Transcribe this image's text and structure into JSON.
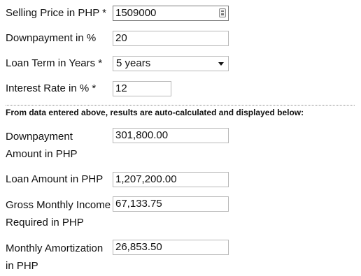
{
  "inputs": {
    "selling_price": {
      "label": "Selling Price in PHP *",
      "value": "1509000",
      "icon": "field-picker-icon"
    },
    "downpayment_percent": {
      "label": "Downpayment in %",
      "value": "20"
    },
    "loan_term": {
      "label": "Loan Term in Years *",
      "selected": "5 years"
    },
    "interest_rate": {
      "label": "Interest Rate in % *",
      "value": "12"
    }
  },
  "notice": "From data entered above, results are auto-calculated and displayed below:",
  "results": {
    "downpayment_amount": {
      "label_line1": "Downpayment",
      "label_line2": "Amount in PHP",
      "value": "301,800.00"
    },
    "loan_amount": {
      "label": "Loan Amount in PHP",
      "value": "1,207,200.00"
    },
    "gross_income": {
      "label_line1": "Gross Monthly Income",
      "label_line2": "Required in PHP",
      "value": "67,133.75"
    },
    "monthly_amortization": {
      "label_line1": "Monthly Amortization",
      "label_line2": "in PHP",
      "value": "26,853.50"
    }
  }
}
